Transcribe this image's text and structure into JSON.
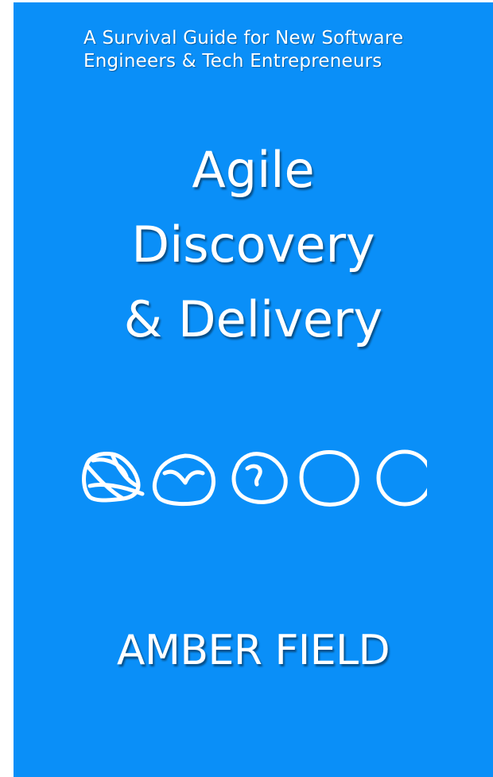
{
  "cover": {
    "background_color": "#0a8ff8",
    "text_color": "#ffffff",
    "subtitle": {
      "line1": "A Survival Guide for New Software",
      "line2": "Engineers & Tech Entrepreneurs"
    },
    "title": {
      "line1": "Agile",
      "line2": "Discovery",
      "line3": "& Delivery"
    },
    "illustration": {
      "description_icon": "hand-drawn-shapes-progressing-to-circle",
      "shape_count": 5
    },
    "author": "AMBER FIELD"
  }
}
